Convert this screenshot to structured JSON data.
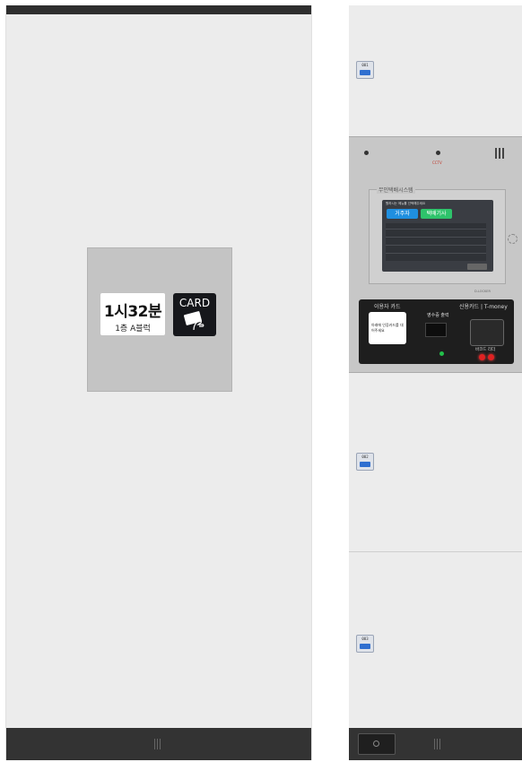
{
  "left_locker": {
    "time_label": "1시32분",
    "block_label": "1층 A블럭",
    "card_reader_label": "CARD"
  },
  "right_column": {
    "doors": [
      {
        "number": "001"
      },
      {
        "number": "002"
      },
      {
        "number": "003"
      }
    ]
  },
  "kiosk": {
    "cctv_label": "CCTV",
    "screen_frame_title": "무인택배시스템",
    "screen_subtitle": "원하시는 메뉴를 선택해주세요",
    "delivery_button": "거주자",
    "pickup_button": "택배기사",
    "user_card_label": "이용자 카드",
    "user_card_prompt": "아래에 인증카드를 대어주세요",
    "receipt_label": "영수증 출력",
    "credit_label": "신용카드 | T-money",
    "barcode_label": "바코드 리더",
    "model_label": "D-LOCKER"
  },
  "colors": {
    "delivery": "#1f8fe0",
    "pickup": "#2ec36b",
    "door_tag_blue": "#2f6fd0",
    "led_red": "#e02222"
  }
}
